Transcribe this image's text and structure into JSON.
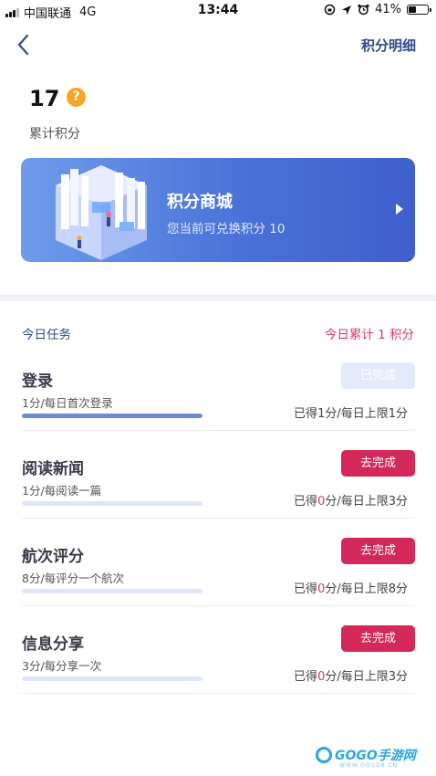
{
  "status_bar": {
    "carrier": "中国联通",
    "network": "4G",
    "time": "13:44",
    "battery": "41%",
    "battery_level": 0.41
  },
  "nav": {
    "back_icon": "chevron-left-icon",
    "detail_link": "积分明细"
  },
  "points": {
    "value": "17",
    "help_icon": "?",
    "label": "累计积分"
  },
  "mall": {
    "title": "积分商城",
    "subtitle": "您当前可兑换积分 10",
    "arrow_icon": "triangle-right-icon"
  },
  "tasks": {
    "title": "今日任务",
    "today_total": "今日累计 1 积分",
    "items": [
      {
        "name": "登录",
        "desc": "1分/每日首次登录",
        "button": "已完成",
        "status": "done",
        "progress": 1.0,
        "limit_prefix": "已得",
        "got": "1",
        "limit_suffix": "分/每日上限1分"
      },
      {
        "name": "阅读新闻",
        "desc": "1分/每阅读一篇",
        "button": "去完成",
        "status": "todo",
        "progress": 0.0,
        "limit_prefix": "已得",
        "got": "0",
        "limit_suffix": "分/每日上限3分"
      },
      {
        "name": "航次评分",
        "desc": "8分/每评分一个航次",
        "button": "去完成",
        "status": "todo",
        "progress": 0.0,
        "limit_prefix": "已得",
        "got": "0",
        "limit_suffix": "分/每日上限8分"
      },
      {
        "name": "信息分享",
        "desc": "3分/每分享一次",
        "button": "去完成",
        "status": "todo",
        "progress": 0.0,
        "limit_prefix": "已得",
        "got": "0",
        "limit_suffix": "分/每日上限3分"
      }
    ]
  },
  "watermark": {
    "brand": "GOGO手游网",
    "url": "WWW.GOGO8.CN"
  },
  "colors": {
    "accent_blue": "#2f4a8a",
    "accent_red": "#d4285a",
    "card_gradient_start": "#6e9bec",
    "card_gradient_end": "#3f5fcc",
    "help_orange": "#f5a623"
  }
}
